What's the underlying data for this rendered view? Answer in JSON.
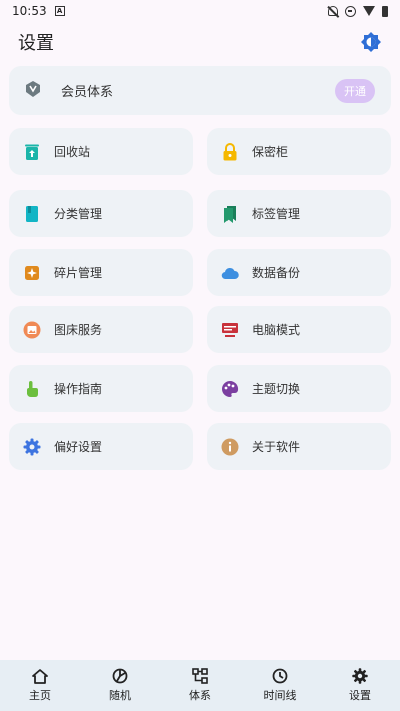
{
  "status_bar": {
    "time": "10:53",
    "app_badge": "A"
  },
  "header": {
    "title": "设置",
    "theme_icon": "theme-toggle-icon"
  },
  "member": {
    "label": "会员体系",
    "action": "开通",
    "icon": "vip-badge-icon"
  },
  "tiles": [
    {
      "label": "回收站",
      "icon": "trash-icon",
      "color": "#1ab5a9"
    },
    {
      "label": "保密柜",
      "icon": "lock-icon",
      "color": "#f5b800"
    },
    {
      "label": "分类管理",
      "icon": "book-icon",
      "color": "#12b5c5"
    },
    {
      "label": "标签管理",
      "icon": "bookmark-icon",
      "color": "#23996d"
    },
    {
      "label": "碎片管理",
      "icon": "sparkle-icon",
      "color": "#e08a1e"
    },
    {
      "label": "数据备份",
      "icon": "cloud-icon",
      "color": "#3d8fe0"
    },
    {
      "label": "图床服务",
      "icon": "image-icon",
      "color": "#f08a55"
    },
    {
      "label": "电脑模式",
      "icon": "desktop-icon",
      "color": "#c8323b"
    },
    {
      "label": "操作指南",
      "icon": "pointer-icon",
      "color": "#6cbf3e"
    },
    {
      "label": "主题切换",
      "icon": "palette-icon",
      "color": "#7b3fa0"
    },
    {
      "label": "偏好设置",
      "icon": "gear-icon",
      "color": "#3d74e0"
    },
    {
      "label": "关于软件",
      "icon": "info-icon",
      "color": "#cf9b61"
    }
  ],
  "bottom_nav": [
    {
      "label": "主页",
      "icon": "home-icon"
    },
    {
      "label": "随机",
      "icon": "random-icon"
    },
    {
      "label": "体系",
      "icon": "hierarchy-icon"
    },
    {
      "label": "时间线",
      "icon": "clock-icon"
    },
    {
      "label": "设置",
      "icon": "settings-icon"
    }
  ]
}
